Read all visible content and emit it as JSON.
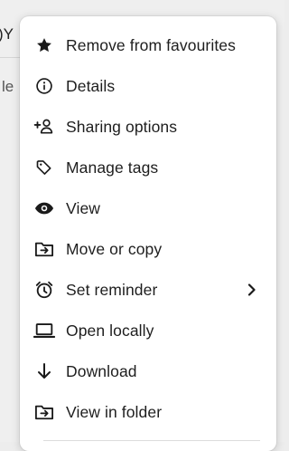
{
  "background": {
    "partial_text_top": ")Y",
    "partial_text_side": "le"
  },
  "menu": {
    "items": [
      {
        "label": "Remove from favourites",
        "icon": "star-filled-icon"
      },
      {
        "label": "Details",
        "icon": "info-circle-icon"
      },
      {
        "label": "Sharing options",
        "icon": "add-person-icon"
      },
      {
        "label": "Manage tags",
        "icon": "tag-icon"
      },
      {
        "label": "View",
        "icon": "eye-icon"
      },
      {
        "label": "Move or copy",
        "icon": "folder-move-icon"
      },
      {
        "label": "Set reminder",
        "icon": "alarm-clock-icon",
        "has_submenu": true
      },
      {
        "label": "Open locally",
        "icon": "laptop-icon"
      },
      {
        "label": "Download",
        "icon": "arrow-down-icon"
      },
      {
        "label": "View in folder",
        "icon": "folder-move-icon"
      }
    ]
  },
  "colors": {
    "text": "#1e1e1e",
    "menu_bg": "#ffffff",
    "page_bg": "#efefef"
  }
}
